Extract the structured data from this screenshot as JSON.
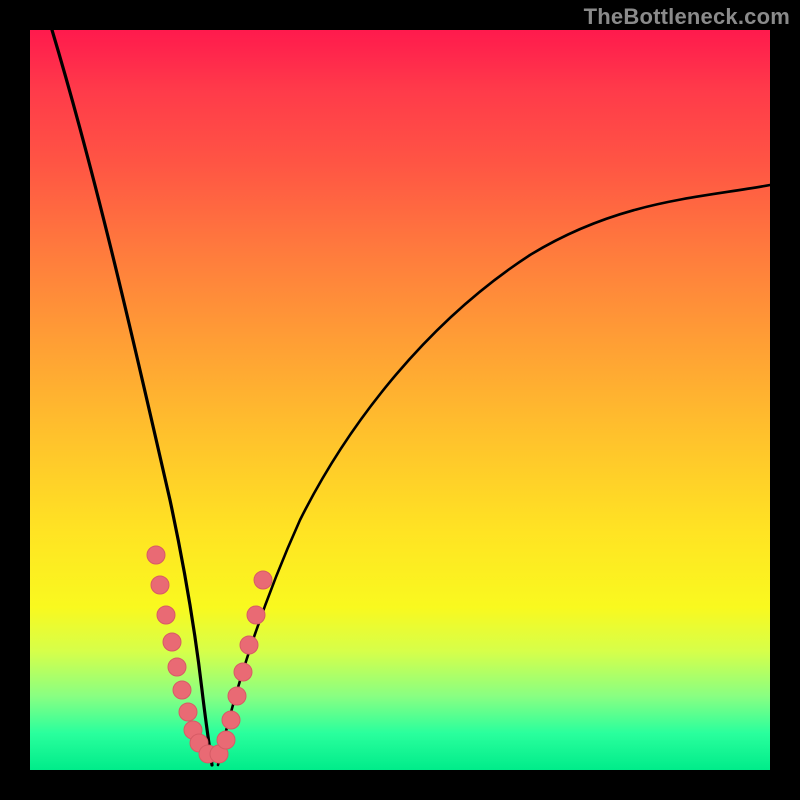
{
  "watermark": "TheBottleneck.com",
  "colors": {
    "background": "#000000",
    "curve_stroke": "#000000",
    "marker_fill": "#e96a74",
    "marker_stroke": "#d75b65"
  },
  "chart_data": {
    "type": "line",
    "title": "",
    "xlabel": "",
    "ylabel": "",
    "xlim": [
      0,
      100
    ],
    "ylim": [
      0,
      100
    ],
    "grid": false,
    "legend": false,
    "note": "Axes are unlabeled in the source; x/y are normalized 0–100 percent of the plot area, y measured from bottom.",
    "series": [
      {
        "name": "left-branch",
        "x": [
          3,
          5,
          8,
          11,
          14,
          16,
          18,
          19,
          20,
          21,
          22,
          23
        ],
        "y": [
          100,
          88,
          72,
          58,
          44,
          33,
          23,
          16,
          11,
          7,
          4,
          1
        ]
      },
      {
        "name": "right-branch",
        "x": [
          25,
          27,
          30,
          34,
          39,
          45,
          52,
          60,
          70,
          82,
          95,
          100
        ],
        "y": [
          1,
          6,
          14,
          24,
          34,
          44,
          53,
          60,
          67,
          73,
          77,
          79
        ]
      }
    ],
    "markers": {
      "name": "data-points",
      "x": [
        17.0,
        17.6,
        18.4,
        19.2,
        19.8,
        20.5,
        21.3,
        22.0,
        22.8,
        24.0,
        25.5,
        26.5,
        27.2,
        28.0,
        28.8,
        29.6,
        30.5,
        31.5
      ],
      "y": [
        29,
        25,
        21,
        17,
        14,
        11,
        8,
        6,
        4,
        2,
        2,
        4,
        7,
        10,
        13,
        17,
        21,
        26
      ]
    }
  }
}
